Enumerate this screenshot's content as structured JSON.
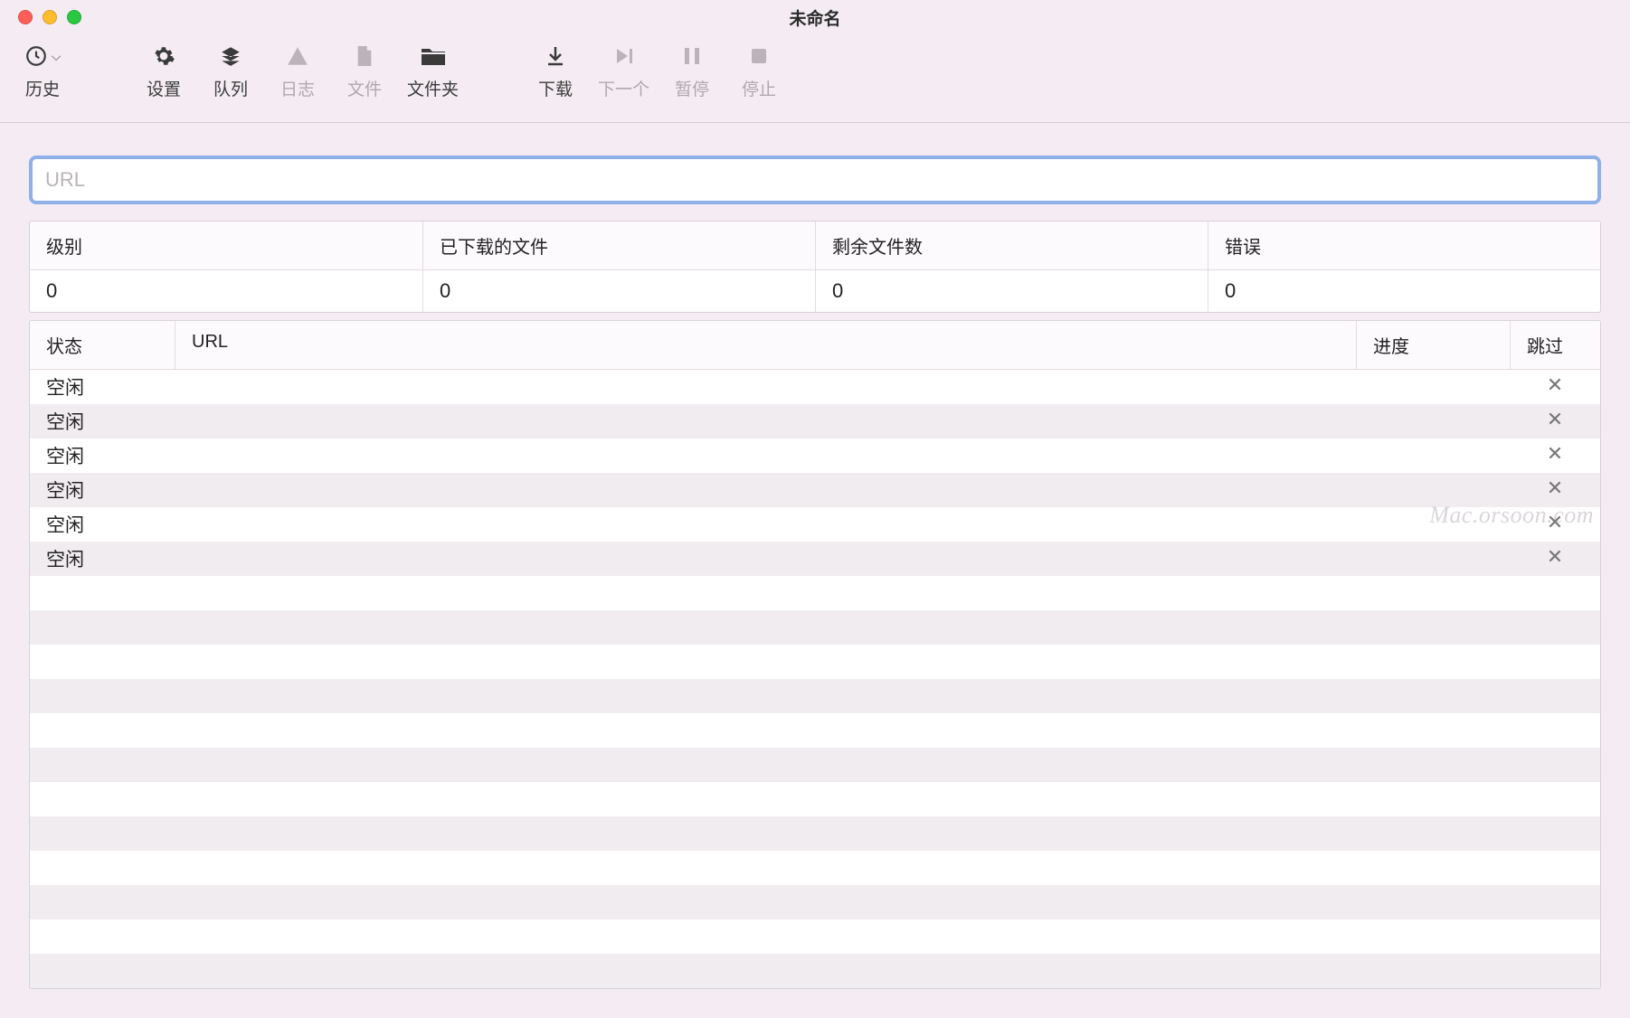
{
  "window": {
    "title": "未命名"
  },
  "toolbar": {
    "history": "历史",
    "settings": "设置",
    "queue": "队列",
    "log": "日志",
    "file": "文件",
    "folder": "文件夹",
    "download": "下载",
    "next": "下一个",
    "pause": "暂停",
    "stop": "停止"
  },
  "url_input": {
    "placeholder": "URL",
    "value": ""
  },
  "stats": {
    "headers": {
      "level": "级别",
      "downloaded": "已下载的文件",
      "remaining": "剩余文件数",
      "errors": "错误"
    },
    "values": {
      "level": "0",
      "downloaded": "0",
      "remaining": "0",
      "errors": "0"
    }
  },
  "table": {
    "headers": {
      "status": "状态",
      "url": "URL",
      "progress": "进度",
      "skip": "跳过"
    },
    "rows": [
      {
        "status": "空闲",
        "url": "",
        "progress": "",
        "skip": true
      },
      {
        "status": "空闲",
        "url": "",
        "progress": "",
        "skip": true
      },
      {
        "status": "空闲",
        "url": "",
        "progress": "",
        "skip": true
      },
      {
        "status": "空闲",
        "url": "",
        "progress": "",
        "skip": true
      },
      {
        "status": "空闲",
        "url": "",
        "progress": "",
        "skip": true
      },
      {
        "status": "空闲",
        "url": "",
        "progress": "",
        "skip": true
      },
      {
        "status": "",
        "url": "",
        "progress": "",
        "skip": false
      },
      {
        "status": "",
        "url": "",
        "progress": "",
        "skip": false
      },
      {
        "status": "",
        "url": "",
        "progress": "",
        "skip": false
      },
      {
        "status": "",
        "url": "",
        "progress": "",
        "skip": false
      },
      {
        "status": "",
        "url": "",
        "progress": "",
        "skip": false
      },
      {
        "status": "",
        "url": "",
        "progress": "",
        "skip": false
      },
      {
        "status": "",
        "url": "",
        "progress": "",
        "skip": false
      },
      {
        "status": "",
        "url": "",
        "progress": "",
        "skip": false
      },
      {
        "status": "",
        "url": "",
        "progress": "",
        "skip": false
      },
      {
        "status": "",
        "url": "",
        "progress": "",
        "skip": false
      },
      {
        "status": "",
        "url": "",
        "progress": "",
        "skip": false
      },
      {
        "status": "",
        "url": "",
        "progress": "",
        "skip": false
      }
    ]
  },
  "watermark": "Mac.orsoon.com"
}
